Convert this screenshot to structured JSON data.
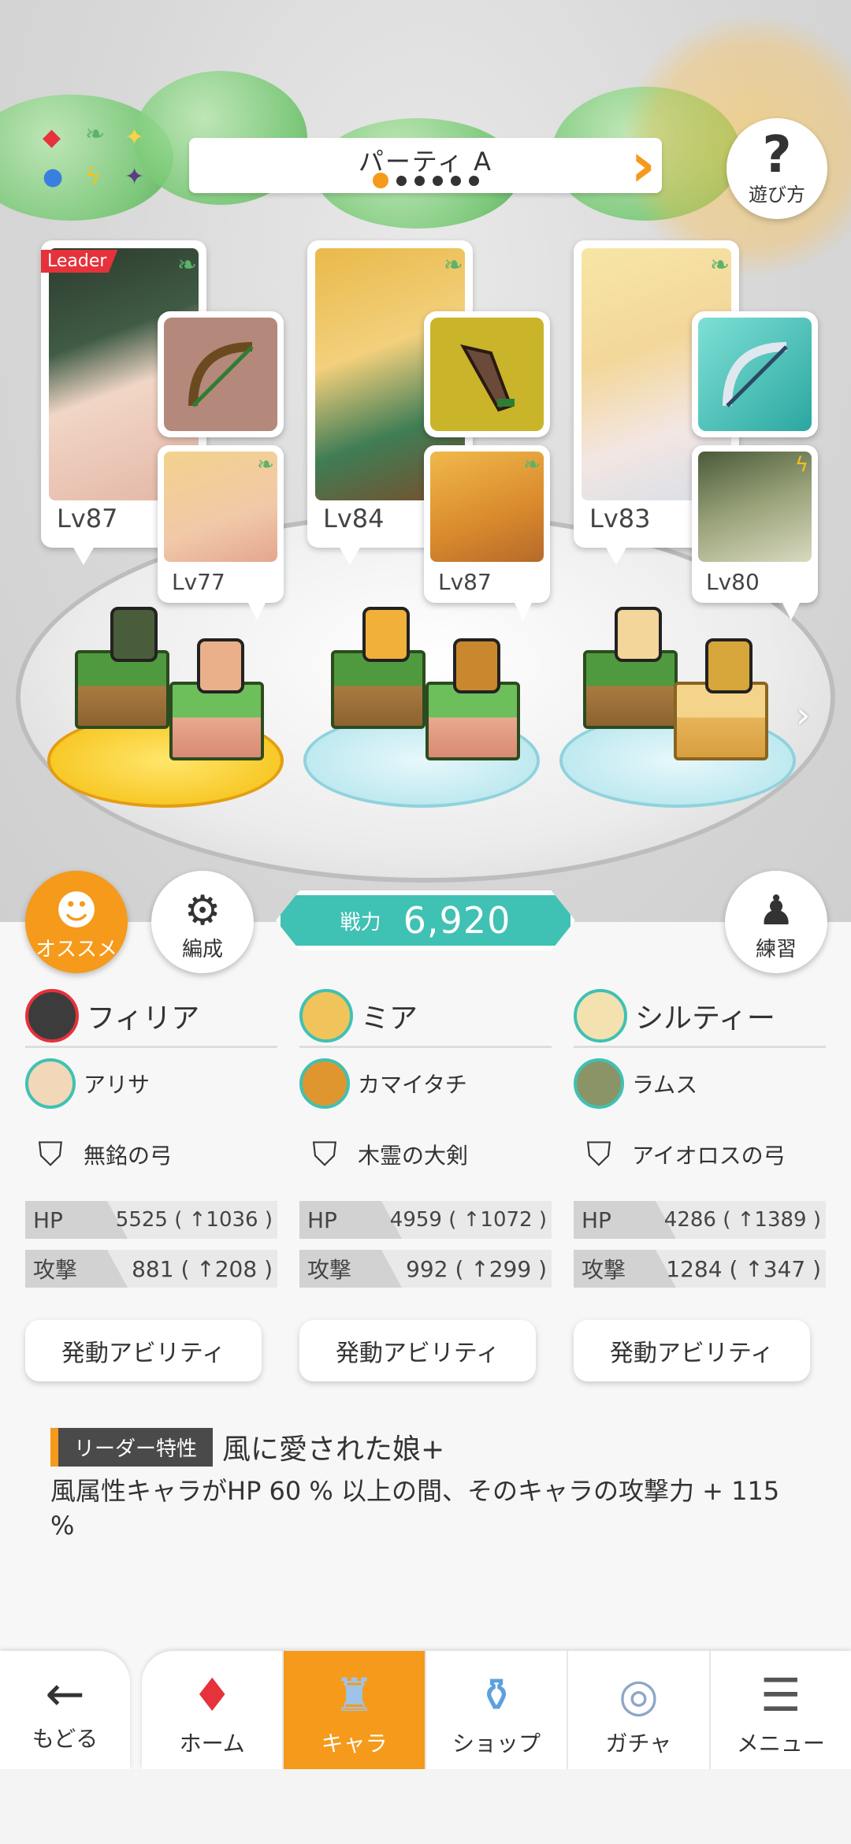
{
  "party": {
    "title": "パーティ A",
    "page_count": 6,
    "current_page": 1,
    "howto_label": "遊び方"
  },
  "colors": {
    "accent": "#f59a1b",
    "teal": "#3fc1b3",
    "leader_red": "#e5323b",
    "wind_green": "#5bb36a"
  },
  "cards": [
    {
      "leader_label": "Leader",
      "level": "Lv87",
      "element_icon": "wind-leaf-icon",
      "weapon_icon": "bow-icon",
      "sub_level": "Lv77",
      "sub_element_icon": "wind-leaf-icon"
    },
    {
      "level": "Lv84",
      "element_icon": "wind-leaf-icon",
      "weapon_icon": "greatsword-icon",
      "sub_level": "Lv87",
      "sub_element_icon": "wind-leaf-icon"
    },
    {
      "level": "Lv83",
      "element_icon": "wind-leaf-icon",
      "weapon_icon": "bow-icon",
      "sub_level": "Lv80",
      "sub_element_icon": "lightning-icon"
    }
  ],
  "buttons": {
    "recommend": "オススメ",
    "formation": "編成",
    "practice": "練習"
  },
  "power": {
    "label": "戦力",
    "value": "6,920"
  },
  "members": [
    {
      "name": "フィリア",
      "sub_name": "アリサ",
      "weapon": "無銘の弓",
      "hp_label": "HP",
      "hp": "5525 ( ↑1036 )",
      "atk_label": "攻撃",
      "atk": "881 ( ↑208 )",
      "ability_button": "発動アビリティ"
    },
    {
      "name": "ミア",
      "sub_name": "カマイタチ",
      "weapon": "木霊の大剣",
      "hp_label": "HP",
      "hp": "4959 ( ↑1072 )",
      "atk_label": "攻撃",
      "atk": "992 ( ↑299 )",
      "ability_button": "発動アビリティ"
    },
    {
      "name": "シルティー",
      "sub_name": "ラムス",
      "weapon": "アイオロスの弓",
      "hp_label": "HP",
      "hp": "4286 ( ↑1389 )",
      "atk_label": "攻撃",
      "atk": "1284 ( ↑347 )",
      "ability_button": "発動アビリティ"
    }
  ],
  "leader_trait": {
    "tag": "リーダー特性",
    "name": "風に愛された娘+",
    "description": "風属性キャラがHP 60 % 以上の間、そのキャラの攻撃力 + 115 %"
  },
  "nav": {
    "back": "もどる",
    "items": [
      {
        "label": "ホーム",
        "icon": "home-icon"
      },
      {
        "label": "キャラ",
        "icon": "character-icon",
        "active": true
      },
      {
        "label": "ショップ",
        "icon": "shop-icon"
      },
      {
        "label": "ガチャ",
        "icon": "gacha-icon"
      },
      {
        "label": "メニュー",
        "icon": "menu-icon"
      }
    ]
  }
}
